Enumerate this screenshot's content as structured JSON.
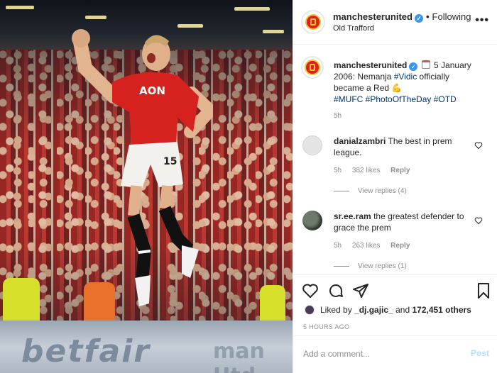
{
  "post_author": {
    "username": "manchesterunited",
    "follow_status": "Following",
    "location": "Old Trafford"
  },
  "caption": {
    "username": "manchesterunited",
    "text_before_tag": "5 January 2006: Nemanja ",
    "mention": "#Vidic",
    "text_after_mention": " officially became a Red",
    "hashtags": "#MUFC #PhotoOfTheDay #OTD",
    "time": "5h"
  },
  "comments": [
    {
      "username": "danialzambri",
      "text": "The best in prem league.",
      "time": "5h",
      "likes": "382 likes",
      "reply_label": "Reply",
      "view_replies": "View replies (4)"
    },
    {
      "username": "sr.ee.ram",
      "text": "the greatest defender to grace the prem",
      "time": "5h",
      "likes": "263 likes",
      "reply_label": "Reply",
      "view_replies": "View replies (1)"
    }
  ],
  "likes_line": {
    "prefix": "Liked by ",
    "user": "_dj.gajic_",
    "conjunction": " and ",
    "others": "172,451 others"
  },
  "posted_time": "5 HOURS AGO",
  "add_comment": {
    "placeholder": "Add a comment...",
    "post_label": "Post"
  },
  "photo": {
    "jersey_number": "15",
    "sponsor": "AON",
    "ad_board_text": "betfair",
    "ad_board_text_2": "man Utd"
  },
  "colors": {
    "verified_blue": "#3897f0",
    "hashtag_blue": "#00376b",
    "muted_gray": "#8e8e8e",
    "post_button_disabled": "#b2dffc",
    "united_red": "#da1f26"
  },
  "icons": [
    "verified-badge-icon",
    "calendar-icon",
    "flexed-biceps-icon",
    "heart-icon",
    "comment-icon",
    "share-icon",
    "bookmark-icon",
    "more-options-icon"
  ]
}
